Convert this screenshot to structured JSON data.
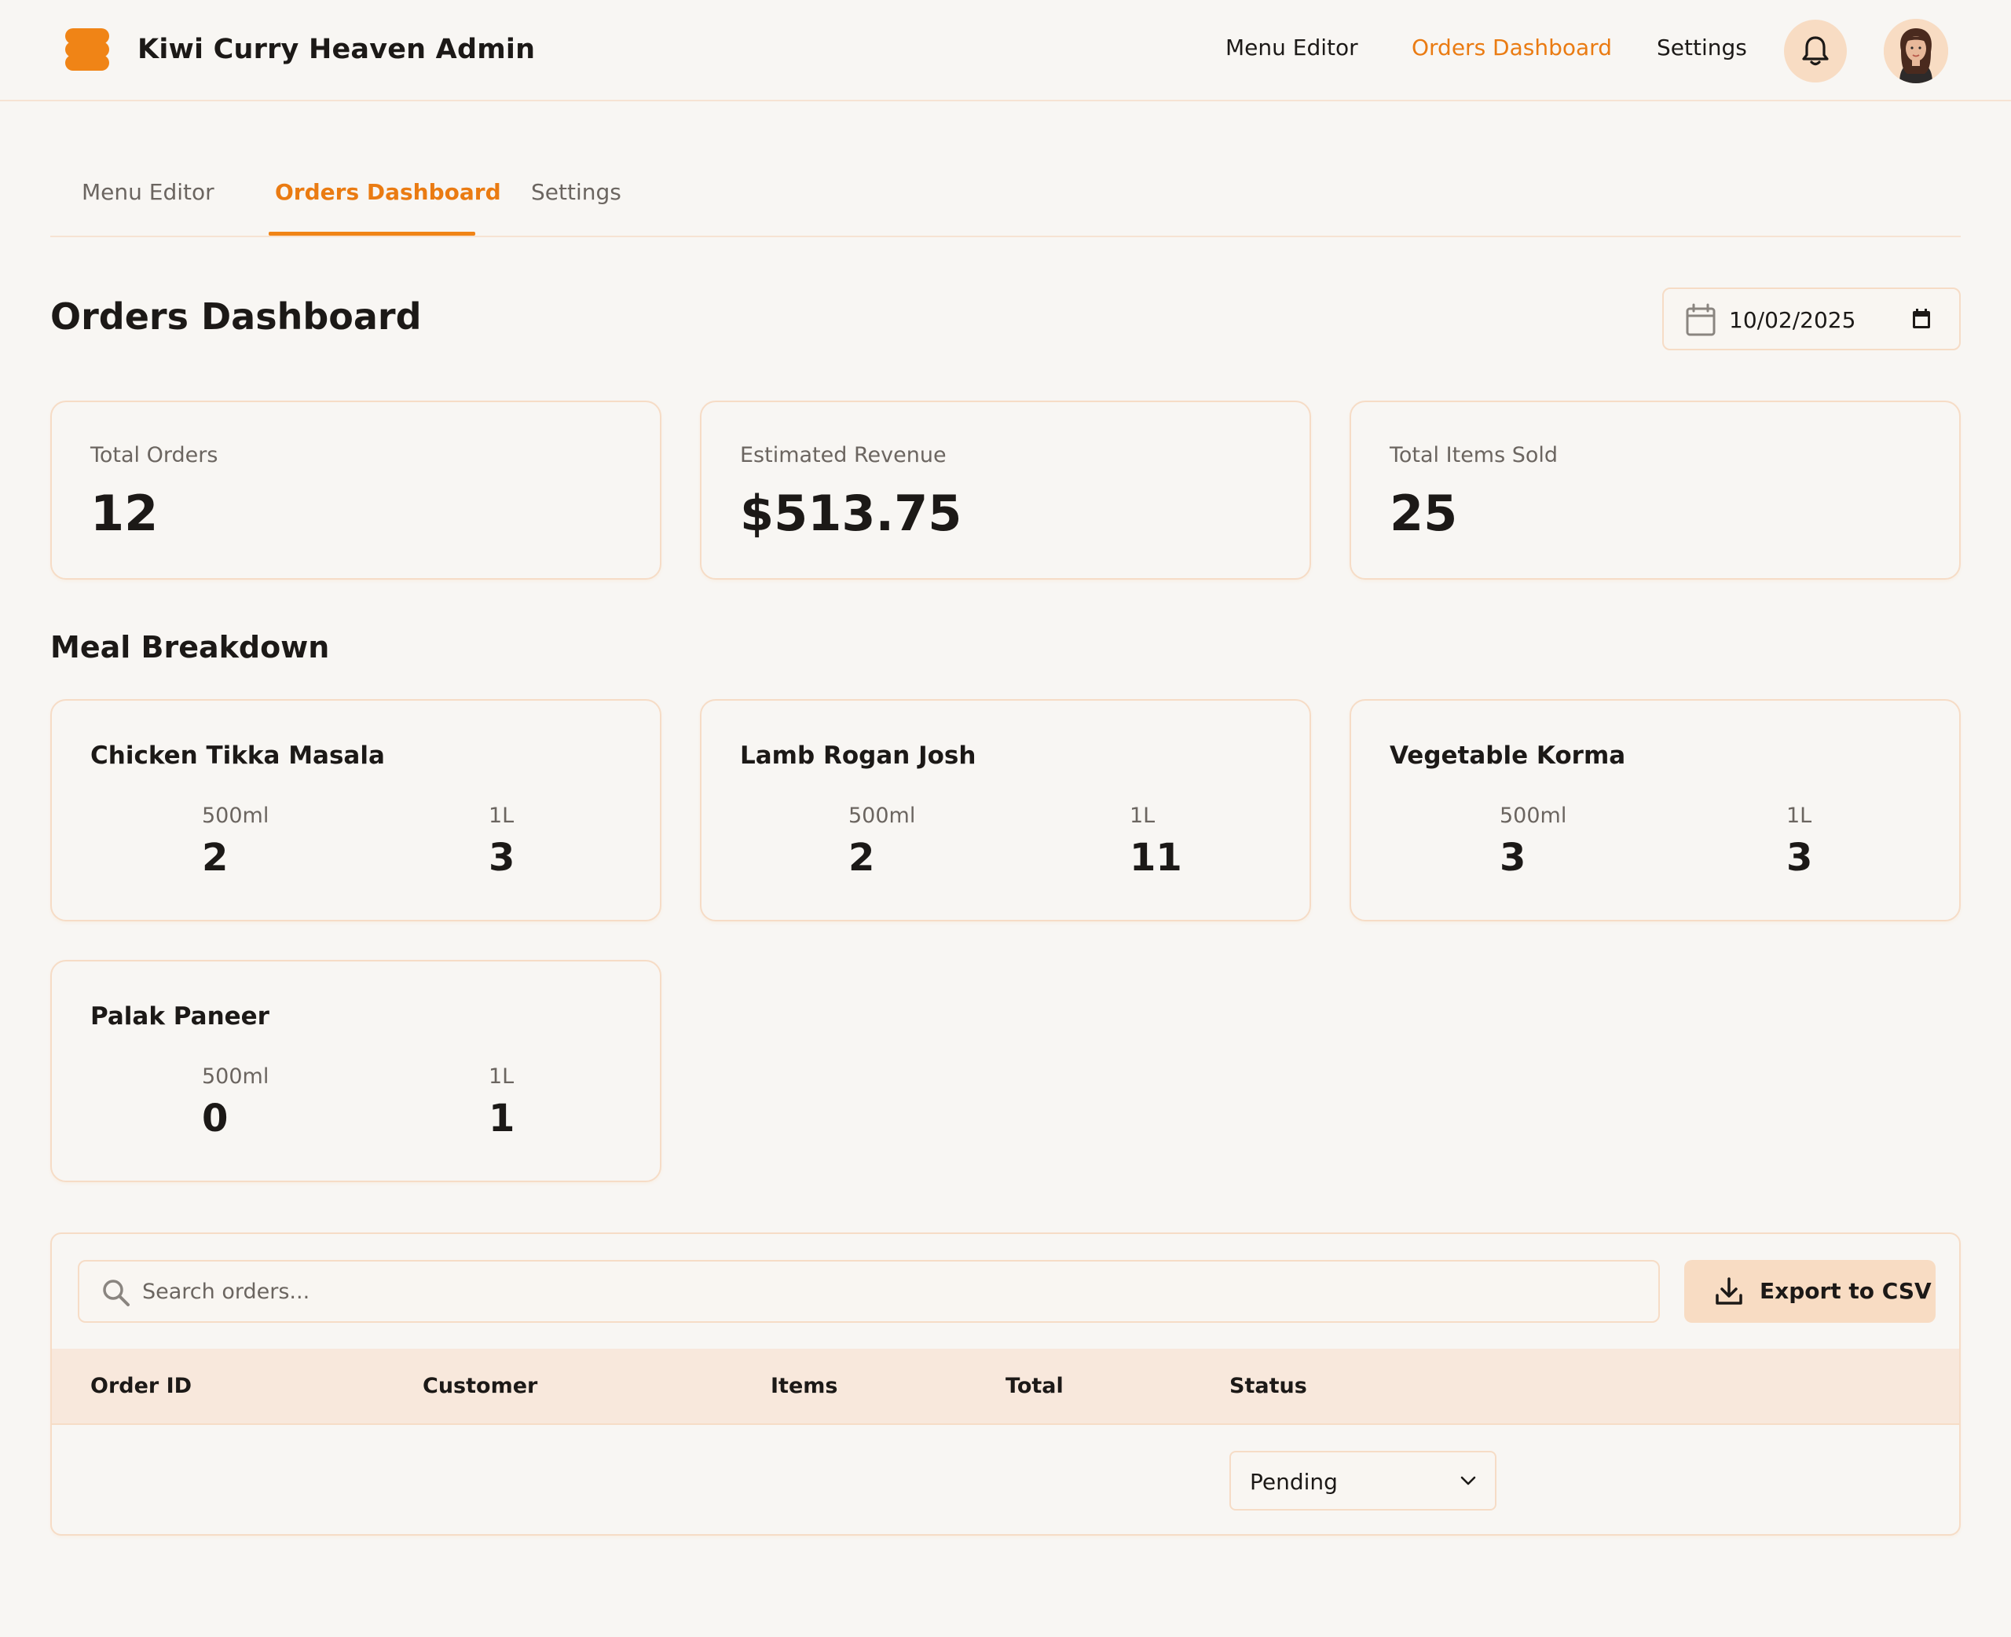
{
  "header": {
    "brand": "Kiwi Curry Heaven Admin",
    "nav": [
      "Menu Editor",
      "Orders Dashboard",
      "Settings"
    ],
    "active_nav": "Orders Dashboard",
    "icons": {
      "notifications": "bell-icon",
      "user": "avatar"
    }
  },
  "tabs": [
    "Menu Editor",
    "Orders Dashboard",
    "Settings"
  ],
  "active_tab": "Orders Dashboard",
  "page": {
    "title": "Orders Dashboard",
    "date": "10/02/2025"
  },
  "stats": [
    {
      "label": "Total Orders",
      "value": "12"
    },
    {
      "label": "Estimated Revenue",
      "value": "$513.75"
    },
    {
      "label": "Total Items Sold",
      "value": "25"
    }
  ],
  "meal_breakdown": {
    "title": "Meal Breakdown",
    "meals": [
      {
        "name": "Chicken Tikka Masala",
        "sizes": [
          {
            "size": "500ml",
            "count": "2"
          },
          {
            "size": "1L",
            "count": "3"
          }
        ]
      },
      {
        "name": "Lamb Rogan Josh",
        "sizes": [
          {
            "size": "500ml",
            "count": "2"
          },
          {
            "size": "1L",
            "count": "11"
          }
        ]
      },
      {
        "name": "Vegetable Korma",
        "sizes": [
          {
            "size": "500ml",
            "count": "3"
          },
          {
            "size": "1L",
            "count": "3"
          }
        ]
      },
      {
        "name": "Palak Paneer",
        "sizes": [
          {
            "size": "500ml",
            "count": "0"
          },
          {
            "size": "1L",
            "count": "1"
          }
        ]
      }
    ]
  },
  "orders": {
    "search_placeholder": "Search orders...",
    "export_label": "Export to CSV",
    "columns": [
      "Order ID",
      "Customer",
      "Items",
      "Total",
      "Status"
    ],
    "rows": [
      {
        "order_id": "",
        "customer": "",
        "items": "",
        "total": "",
        "status": "Pending"
      }
    ]
  },
  "colors": {
    "accent": "#f08416",
    "accent_text": "#ea7b12",
    "background": "#f8f6f3",
    "card_border": "#f6dcc6",
    "table_header": "#f8e8dc",
    "button_bg": "#f8dcc3"
  }
}
